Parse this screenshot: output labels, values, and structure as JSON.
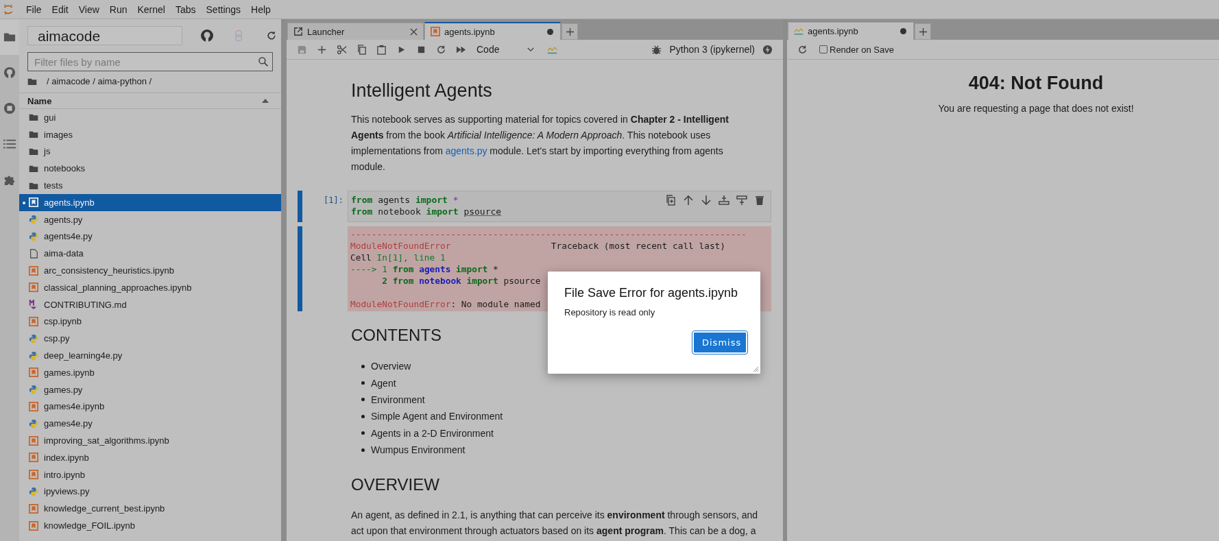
{
  "menu": [
    "File",
    "Edit",
    "View",
    "Run",
    "Kernel",
    "Tabs",
    "Settings",
    "Help"
  ],
  "file_browser": {
    "repo": "aimacode",
    "filter_placeholder": "Filter files by name",
    "breadcrumb": [
      "/ aimacode / aima-python /"
    ],
    "column": "Name",
    "items": [
      {
        "name": "gui",
        "kind": "folder",
        "selected": false
      },
      {
        "name": "images",
        "kind": "folder",
        "selected": false
      },
      {
        "name": "js",
        "kind": "folder",
        "selected": false
      },
      {
        "name": "notebooks",
        "kind": "folder",
        "selected": false
      },
      {
        "name": "tests",
        "kind": "folder",
        "selected": false
      },
      {
        "name": "agents.ipynb",
        "kind": "notebook",
        "selected": true
      },
      {
        "name": "agents.py",
        "kind": "python",
        "selected": false
      },
      {
        "name": "agents4e.py",
        "kind": "python",
        "selected": false
      },
      {
        "name": "aima-data",
        "kind": "file",
        "selected": false
      },
      {
        "name": "arc_consistency_heuristics.ipynb",
        "kind": "notebook",
        "selected": false
      },
      {
        "name": "classical_planning_approaches.ipynb",
        "kind": "notebook",
        "selected": false
      },
      {
        "name": "CONTRIBUTING.md",
        "kind": "markdown",
        "selected": false
      },
      {
        "name": "csp.ipynb",
        "kind": "notebook",
        "selected": false
      },
      {
        "name": "csp.py",
        "kind": "python",
        "selected": false
      },
      {
        "name": "deep_learning4e.py",
        "kind": "python",
        "selected": false
      },
      {
        "name": "games.ipynb",
        "kind": "notebook",
        "selected": false
      },
      {
        "name": "games.py",
        "kind": "python",
        "selected": false
      },
      {
        "name": "games4e.ipynb",
        "kind": "notebook",
        "selected": false
      },
      {
        "name": "games4e.py",
        "kind": "python",
        "selected": false
      },
      {
        "name": "improving_sat_algorithms.ipynb",
        "kind": "notebook",
        "selected": false
      },
      {
        "name": "index.ipynb",
        "kind": "notebook",
        "selected": false
      },
      {
        "name": "intro.ipynb",
        "kind": "notebook",
        "selected": false
      },
      {
        "name": "ipyviews.py",
        "kind": "python",
        "selected": false
      },
      {
        "name": "knowledge_current_best.ipynb",
        "kind": "notebook",
        "selected": false
      },
      {
        "name": "knowledge_FOIL.ipynb",
        "kind": "notebook",
        "selected": false
      }
    ]
  },
  "notebook": {
    "tabs": [
      {
        "label": "Launcher",
        "kind": "launcher",
        "selected": false,
        "modified": false
      },
      {
        "label": "agents.ipynb",
        "kind": "notebook",
        "selected": true,
        "modified": true
      }
    ],
    "cell_type": "Code",
    "kernel": "Python 3 (ipykernel)",
    "title": "Intelligent Agents",
    "intro": [
      {
        "kind": "text",
        "text": "This notebook serves as supporting material for topics covered in **Chapter 2 - Intelligent Agents** from the book *Artificial Intelligence: A Modern Approach*. This notebook uses implementations from "
      },
      {
        "kind": "link",
        "text": "agents.py"
      },
      {
        "kind": "text",
        "text": " module. Let's start by importing everything from agents module."
      }
    ],
    "prompt": "[1]:",
    "code": [
      [
        {
          "kind": "kw",
          "text": "from"
        },
        {
          "kind": "plain",
          "text": " agents "
        },
        {
          "kind": "kw",
          "text": "import"
        },
        {
          "kind": "op",
          "text": " *"
        }
      ],
      [
        {
          "kind": "kw",
          "text": "from"
        },
        {
          "kind": "plain",
          "text": " notebook "
        },
        {
          "kind": "kw",
          "text": "import "
        },
        {
          "kind": "err",
          "text": "psource"
        }
      ]
    ],
    "output": [
      {
        "spaced": false,
        "tokens": [
          {
            "kind": "red",
            "text": "---------------------------------------------------------------------------"
          }
        ]
      },
      {
        "spaced": false,
        "tokens": [
          {
            "kind": "red",
            "text": "ModuleNotFoundError"
          },
          {
            "kind": "plain",
            "text": "                   Traceback (most recent call last)"
          }
        ]
      },
      {
        "spaced": false,
        "tokens": [
          {
            "kind": "plain",
            "text": "Cell "
          },
          {
            "kind": "green",
            "text": "In[1], line 1"
          }
        ]
      },
      {
        "spaced": false,
        "tokens": [
          {
            "kind": "green",
            "text": "----> 1 "
          },
          {
            "kind": "gbold",
            "text": "from"
          },
          {
            "kind": "bbold",
            "text": " agents"
          },
          {
            "kind": "gbold",
            "text": " import"
          },
          {
            "kind": "plain",
            "text": " *"
          }
        ]
      },
      {
        "spaced": false,
        "tokens": [
          {
            "kind": "gbold",
            "text": "      2 from"
          },
          {
            "kind": "bbold",
            "text": " notebook"
          },
          {
            "kind": "gbold",
            "text": " import"
          },
          {
            "kind": "plain",
            "text": " psource"
          }
        ]
      },
      {
        "spaced": true,
        "tokens": [
          {
            "kind": "red",
            "text": "ModuleNotFoundError"
          },
          {
            "kind": "plain",
            "text": ": No module named"
          }
        ]
      }
    ],
    "contents_heading": "CONTENTS",
    "contents": [
      "Overview",
      "Agent",
      "Environment",
      "Simple Agent and Environment",
      "Agents in a 2-D Environment",
      "Wumpus Environment"
    ],
    "overview_heading": "OVERVIEW",
    "overview": "An agent, as defined in 2.1, is anything that can perceive its **environment** through sensors, and act upon that environment through actuators based on its **agent program**. This can be a dog, a"
  },
  "preview": {
    "tab": {
      "label": "agents.ipynb",
      "modified": true
    },
    "render_on_save": {
      "label": "Render on Save",
      "checked": false
    },
    "title": "404: Not Found",
    "message": "You are requesting a page that does not exist!"
  },
  "dialog": {
    "title": "File Save Error for agents.ipynb",
    "message": "Repository is read only",
    "button": "Dismiss"
  }
}
